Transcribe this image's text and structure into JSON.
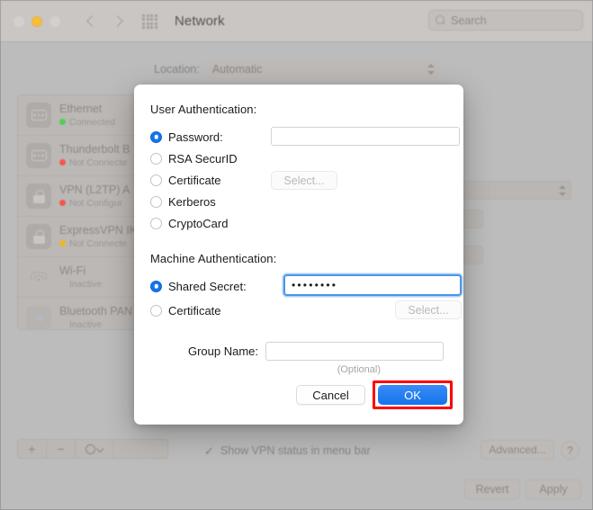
{
  "window": {
    "title": "Network",
    "traffic_lights": [
      "close",
      "minimize",
      "zoom"
    ],
    "search": {
      "placeholder": "Search",
      "value": ""
    },
    "nav": {
      "back": "back-arrow",
      "forward": "forward-arrow",
      "grid": "show-all-grid"
    }
  },
  "location": {
    "label": "Location:",
    "value": "Automatic"
  },
  "sidebar": {
    "items": [
      {
        "name": "Ethernet",
        "status": "Connected",
        "dot": "#4cd05a",
        "icon": "ethernet-icon"
      },
      {
        "name": "Thunderbolt B",
        "status": "Not Connecte",
        "dot": "#f2564e",
        "icon": "ethernet-icon"
      },
      {
        "name": "VPN (L2TP) A",
        "status": "Not Configur",
        "dot": "#f2564e",
        "icon": "lock-icon"
      },
      {
        "name": "ExpressVPN IK",
        "status": "Not Connecte",
        "dot": "#f0b429",
        "icon": "lock-icon"
      },
      {
        "name": "Wi-Fi",
        "status": "Inactive",
        "dot": "",
        "icon": "wifi-icon"
      },
      {
        "name": "Bluetooth PAN",
        "status": "Inactive",
        "dot": "",
        "icon": "bluetooth-icon"
      }
    ],
    "actions": {
      "add": "+",
      "remove": "−",
      "menu": "gear-dropdown"
    }
  },
  "footer": {
    "vpn_status_label": "Show VPN status in menu bar",
    "vpn_status_checked": true,
    "advanced_label": "Advanced...",
    "help_label": "?",
    "revert_label": "Revert",
    "apply_label": "Apply"
  },
  "dialog": {
    "user_auth": {
      "title": "User Authentication:",
      "selected": "Password",
      "options": [
        {
          "label": "Password:",
          "selected": true
        },
        {
          "label": "RSA SecurID",
          "selected": false
        },
        {
          "label": "Certificate",
          "selected": false
        },
        {
          "label": "Kerberos",
          "selected": false
        },
        {
          "label": "CryptoCard",
          "selected": false
        }
      ],
      "password_value": "",
      "select_label": "Select..."
    },
    "machine_auth": {
      "title": "Machine Authentication:",
      "selected": "Shared Secret",
      "options": [
        {
          "label": "Shared Secret:",
          "selected": true
        },
        {
          "label": "Certificate",
          "selected": false
        }
      ],
      "shared_secret_value": "••••••••",
      "select_label": "Select..."
    },
    "group_name": {
      "label": "Group Name:",
      "value": "",
      "note": "(Optional)"
    },
    "buttons": {
      "cancel": "Cancel",
      "ok": "OK"
    },
    "highlight_color": "#ff0000",
    "accent_color": "#1474ec"
  }
}
